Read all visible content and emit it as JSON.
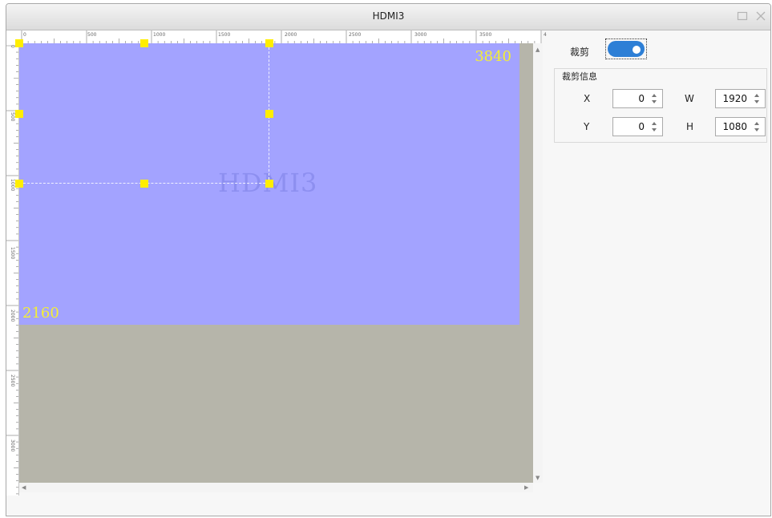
{
  "window": {
    "title": "HDMI3"
  },
  "ruler": {
    "top_labels": [
      "0",
      "500",
      "1000",
      "1500",
      "2000",
      "2500",
      "3000",
      "3500",
      "4"
    ],
    "left_labels": [
      "0",
      "500",
      "1000",
      "1500",
      "2000",
      "2500",
      "3000"
    ]
  },
  "canvas": {
    "source_name": "HDMI3",
    "width_label": "3840",
    "height_label": "2160",
    "colors": {
      "source": "#a3a3ff",
      "background": "#b6b5aa",
      "handle": "#ffee00",
      "dim_text": "#f4ef33"
    }
  },
  "panel": {
    "crop_label": "裁剪",
    "crop_enabled": true,
    "group_title": "裁剪信息",
    "fields": {
      "x": {
        "label": "X",
        "value": "0"
      },
      "y": {
        "label": "Y",
        "value": "0"
      },
      "w": {
        "label": "W",
        "value": "1920"
      },
      "h": {
        "label": "H",
        "value": "1080"
      }
    },
    "accent": "#2d7fd6"
  }
}
